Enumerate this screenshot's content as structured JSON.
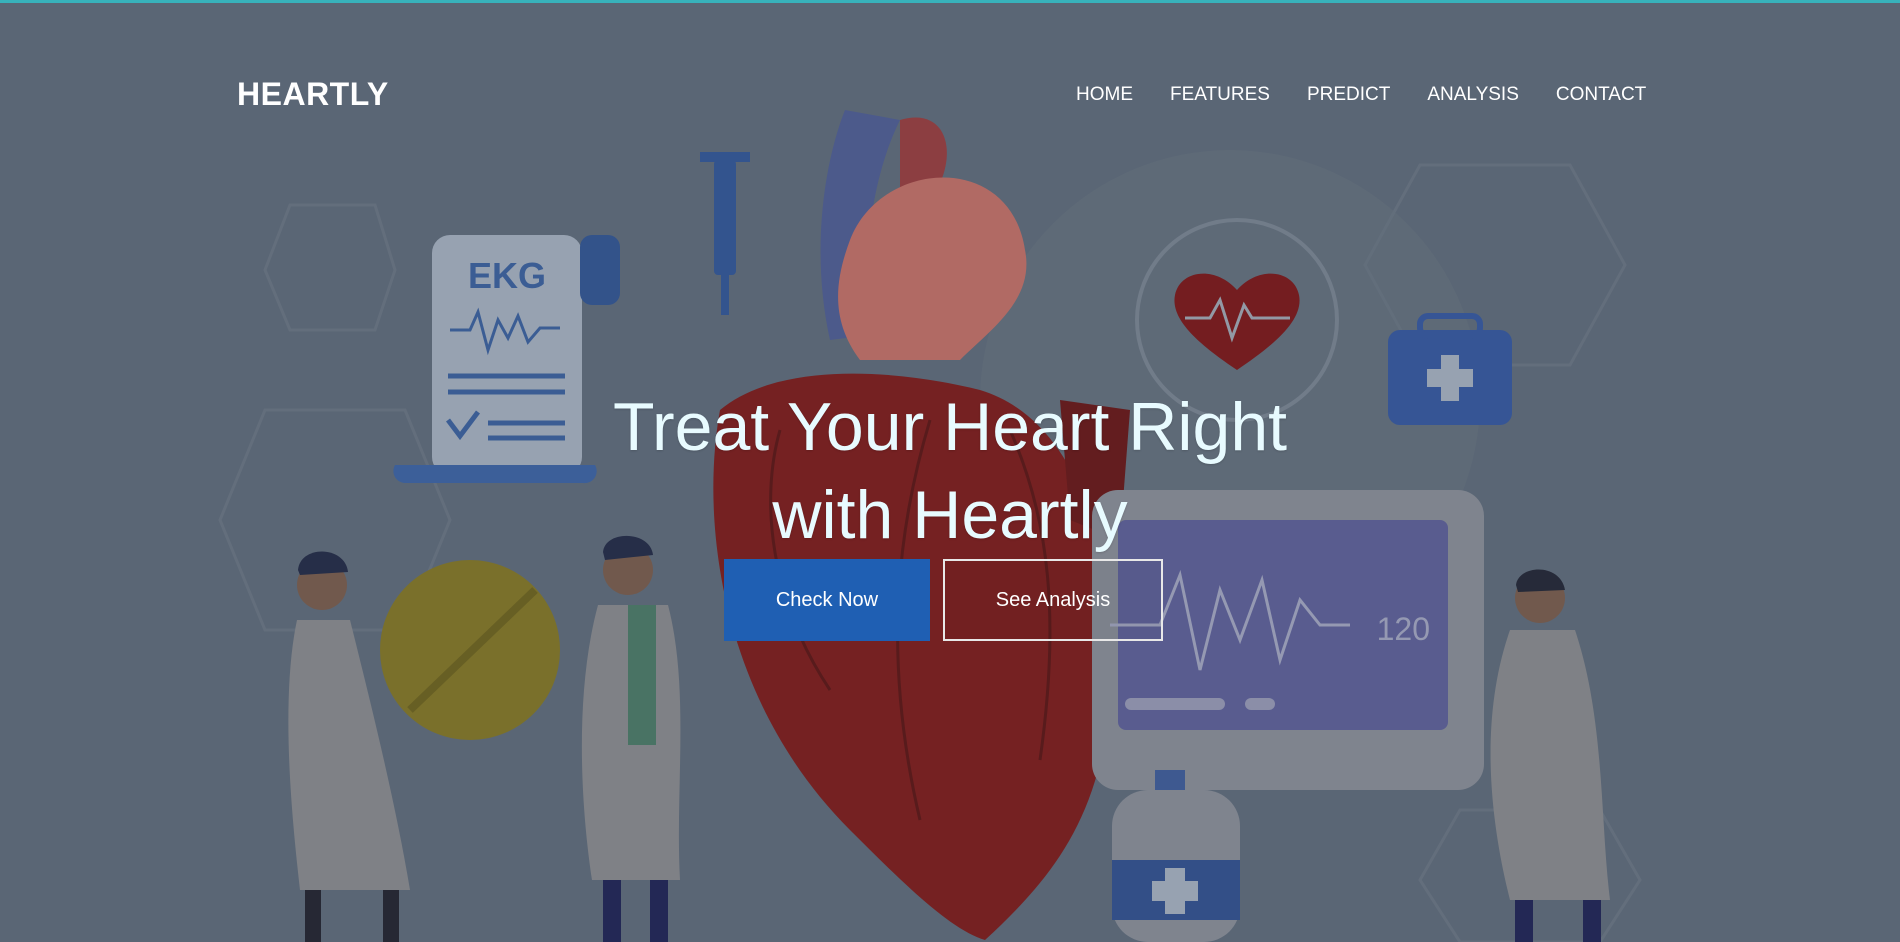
{
  "brand": {
    "name": "HEARTLY"
  },
  "nav": {
    "items": [
      {
        "label": "HOME"
      },
      {
        "label": "FEATURES"
      },
      {
        "label": "PREDICT"
      },
      {
        "label": "ANALYSIS"
      },
      {
        "label": "CONTACT"
      }
    ]
  },
  "hero": {
    "title_line1": "Treat Your Heart Right",
    "title_line2": "with Heartly",
    "primary_button": "Check Now",
    "secondary_button": "See Analysis"
  },
  "illustration": {
    "ekg_label": "EKG",
    "monitor_reading": "120"
  },
  "colors": {
    "accent_top": "#35c7cf",
    "primary_button": "#1f5fb3",
    "heart_red": "#8b1a18",
    "background": "#5f6b79"
  }
}
